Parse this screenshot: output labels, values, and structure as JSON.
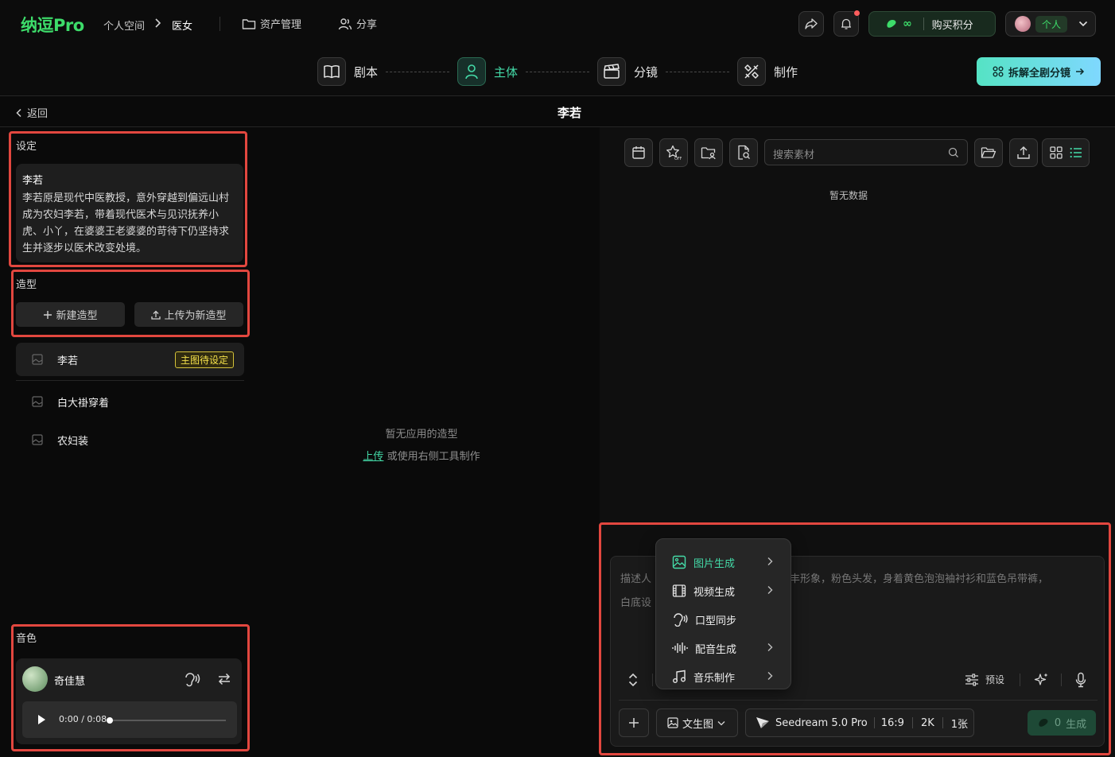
{
  "header": {
    "logo": "纳逗Pro",
    "breadcrumb": [
      "个人空间",
      "医女"
    ],
    "nav": [
      {
        "label": "资产管理"
      },
      {
        "label": "分享"
      }
    ],
    "points": "∞",
    "buy_points": "购买积分",
    "account": "个人"
  },
  "steps": [
    {
      "label": "剧本"
    },
    {
      "label": "主体",
      "active": true
    },
    {
      "label": "分镜"
    },
    {
      "label": "制作"
    }
  ],
  "decompose_button": "拆解全剧分镜",
  "page": {
    "back": "返回",
    "title": "李若"
  },
  "left": {
    "setting_label": "设定",
    "setting": {
      "name": "李若",
      "description": "李若原是现代中医教授，意外穿越到偏远山村成为农妇李若，带着现代医术与见识抚养小虎、小丫，在婆婆王老婆婆的苛待下仍坚持求生并逐步以医术改变处境。"
    },
    "look_label": "造型",
    "new_look": "新建造型",
    "upload_look": "上传为新造型",
    "looks": [
      {
        "name": "李若",
        "badge": "主图待设定"
      },
      {
        "name": "白大褂穿着"
      },
      {
        "name": "农妇装"
      }
    ],
    "voice_label": "音色",
    "voice": {
      "name": "奇佳慧",
      "time": "0:00 / 0:08",
      "progress": 0
    }
  },
  "center": {
    "empty": "暂无应用的造型",
    "upload_link": "上传",
    "hint": "或使用右侧工具制作"
  },
  "right": {
    "search_placeholder": "搜索素材",
    "no_data": "暂无数据",
    "prompt_placeholder_left_1": "描述人",
    "prompt_placeholder_right_1": "丰形象，粉色头发，身着黄色泡泡袖衬衫和蓝色吊带裤，",
    "prompt_placeholder_left_2": "白底设",
    "preset": "预设",
    "mode": "文生图",
    "model": "Seedream 5.0 Pro",
    "ratio": "16:9",
    "resolution": "2K",
    "count": "1张",
    "generate_count": "0",
    "generate": "生成"
  },
  "menu": [
    {
      "label": "图片生成",
      "active": true,
      "submenu": true
    },
    {
      "label": "视频生成",
      "submenu": true
    },
    {
      "label": "口型同步",
      "submenu": false
    },
    {
      "label": "配音生成",
      "submenu": true
    },
    {
      "label": "音乐制作",
      "submenu": true
    }
  ],
  "colors": {
    "accent_green": "#3ddc6a",
    "accent_teal": "#44dba8",
    "highlight_red": "#e2473f",
    "badge_yellow": "#f3e04a"
  }
}
